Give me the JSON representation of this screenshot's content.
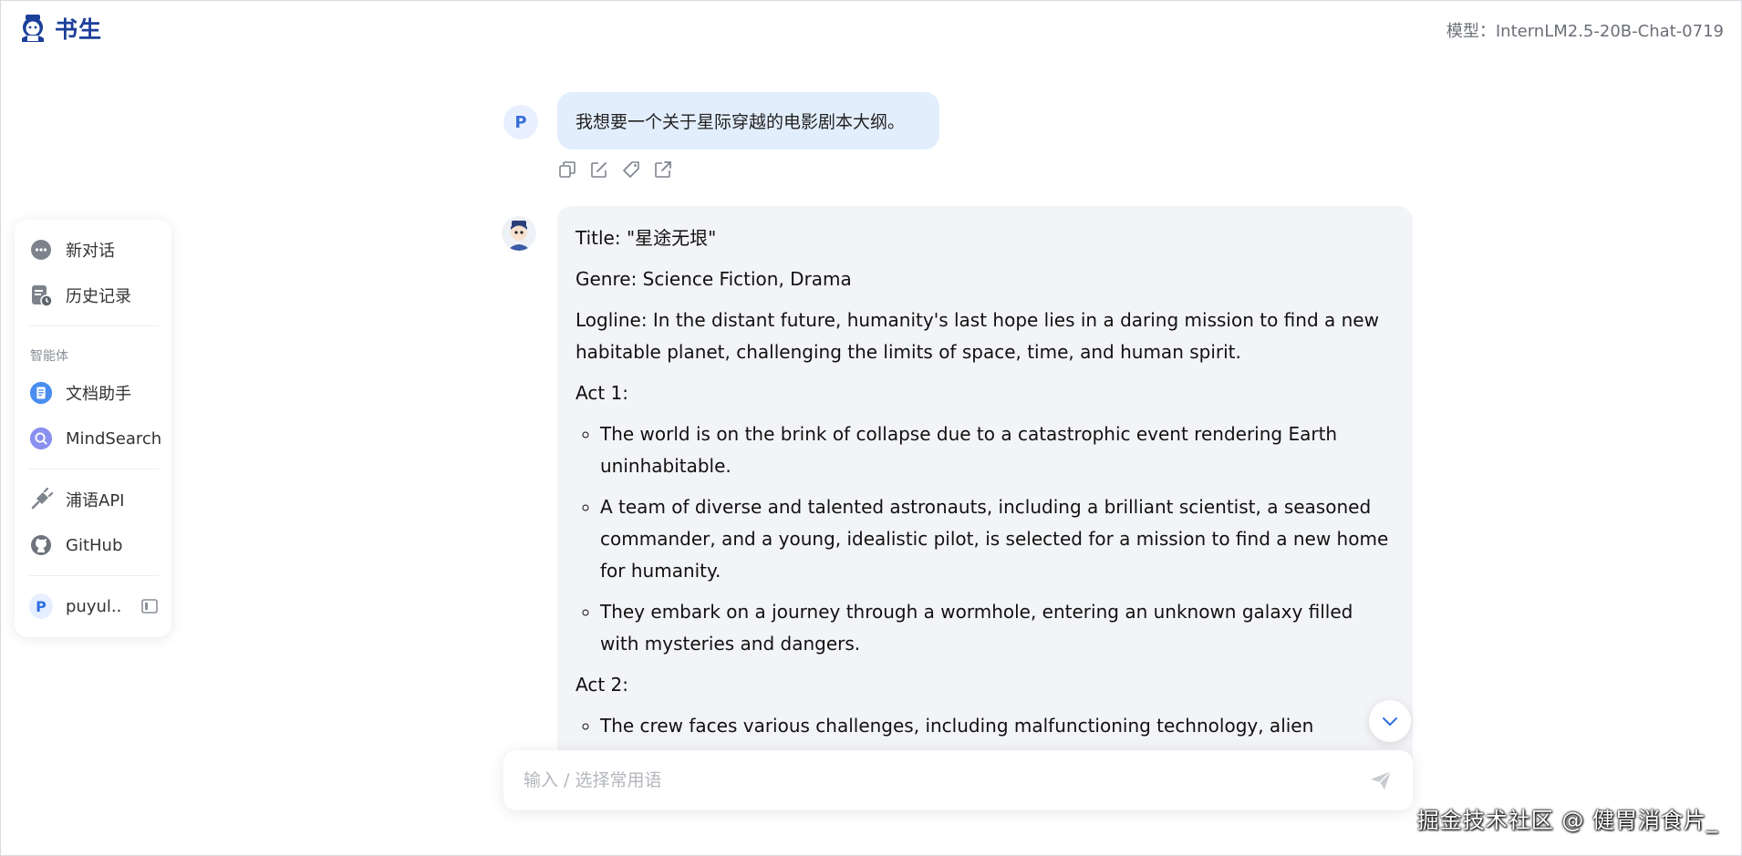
{
  "brand": {
    "name": "书生"
  },
  "header": {
    "model_text": "模型：InternLM2.5-20B-Chat-0719"
  },
  "sidebar": {
    "items": [
      {
        "label": "新对话",
        "icon": "chat-bubble-icon"
      },
      {
        "label": "历史记录",
        "icon": "history-icon"
      }
    ],
    "section_title": "智能体",
    "agents": [
      {
        "label": "文档助手",
        "icon": "document-assistant-icon"
      },
      {
        "label": "MindSearch",
        "icon": "mindsearch-icon"
      }
    ],
    "links": [
      {
        "label": "浦语API",
        "icon": "api-plug-icon"
      },
      {
        "label": "GitHub",
        "icon": "github-icon"
      }
    ],
    "user": {
      "avatar_letter": "P",
      "name": "puyul..."
    }
  },
  "chat": {
    "user_avatar_letter": "P",
    "user_message": "我想要一个关于星际穿越的电影剧本大纲。",
    "bot": {
      "title": "Title: \"星途无垠\"",
      "genre": "Genre: Science Fiction, Drama",
      "logline": "Logline: In the distant future, humanity's last hope lies in a daring mission to find a new habitable planet, challenging the limits of space, time, and human spirit.",
      "act1_heading": "Act 1:",
      "act1_items": [
        "The world is on the brink of collapse due to a catastrophic event rendering Earth uninhabitable.",
        "A team of diverse and talented astronauts, including a brilliant scientist, a seasoned commander, and a young, idealistic pilot, is selected for a mission to find a new home for humanity.",
        "They embark on a journey through a wormhole, entering an unknown galaxy filled with mysteries and dangers."
      ],
      "act2_heading": "Act 2:",
      "act2_items": [
        "The crew faces various challenges, including malfunctioning technology, alien encounters,"
      ]
    }
  },
  "input": {
    "placeholder": "输入 / 选择常用语"
  },
  "watermark": "掘金技术社区 @ 健胃消食片_",
  "colors": {
    "accent": "#2f6fe4",
    "user_bubble": "#e3eefd",
    "bot_bubble": "#f3f4f7",
    "brand": "#1c3f9a"
  }
}
